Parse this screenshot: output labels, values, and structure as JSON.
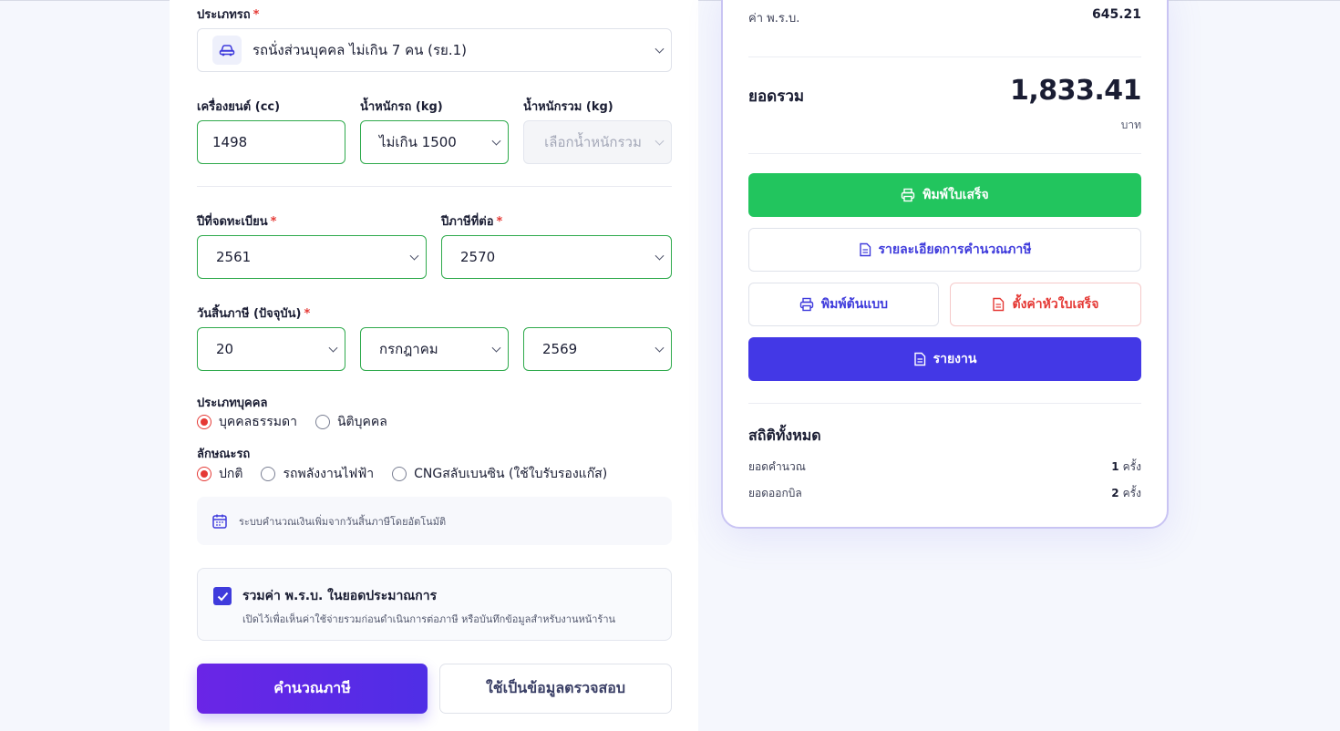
{
  "form": {
    "vehicle_type": {
      "label": "ประเภทรถ",
      "required_mark": "*",
      "value": "รถนั่งส่วนบุคคล ไม่เกิน 7 คน (รย.1)",
      "icon": "car-icon"
    },
    "engine_cc": {
      "label": "เครื่องยนต์ (cc)",
      "value": "1498"
    },
    "vehicle_weight": {
      "label": "น้ำหนักรถ (kg)",
      "value": "ไม่เกิน 1500"
    },
    "gross_weight": {
      "label": "น้ำหนักรวม (kg)",
      "placeholder": "เลือกน้ำหนักรวม"
    },
    "registration_year": {
      "label": "ปีที่จดทะเบียน",
      "required_mark": "*",
      "value": "2561"
    },
    "tax_year": {
      "label": "ปีภาษีที่ต่อ",
      "required_mark": "*",
      "value": "2570"
    },
    "tax_expiry": {
      "label": "วันสิ้นภาษี (ปัจจุบัน)",
      "required_mark": "*",
      "day": "20",
      "month": "กรกฎาคม",
      "year": "2569"
    },
    "person_type": {
      "label": "ประเภทบุคคล",
      "options": [
        "บุคคลธรรมดา",
        "นิติบุคคล"
      ],
      "selected": "บุคคลธรรมดา"
    },
    "vehicle_kind": {
      "label": "ลักษณะรถ",
      "options": [
        "ปกติ",
        "รถพลังงานไฟฟ้า",
        "CNGสลับเบนซิน (ใช้ใบรับรองแก๊ส)"
      ],
      "selected": "ปกติ"
    },
    "auto_note": "ระบบคำนวณเงินเพิ่มจากวันสิ้นภาษีโดยอัตโนมัติ",
    "include_prb": {
      "checked": true,
      "title": "รวมค่า พ.ร.บ. ในยอดประมาณการ",
      "description": "เปิดไว้เพื่อเห็นค่าใช้จ่ายรวมก่อนดำเนินการต่อภาษี หรือบันทึกข้อมูลสำหรับงานหน้าร้าน"
    },
    "calculate_label": "คำนวณภาษี",
    "test_data_label": "ใช้เป็นข้อมูลตรวจสอบ"
  },
  "summary": {
    "prb_label": "ค่า พ.ร.บ.",
    "prb_value": "645.21",
    "total_label": "ยอดรวม",
    "total_value": "1,833.41",
    "total_unit": "บาท",
    "print_receipt_label": "พิมพ์ใบเสร็จ",
    "tax_detail_label": "รายละเอียดการคำนวณภาษี",
    "print_draft_label": "พิมพ์ต้นแบบ",
    "receipt_header_label": "ตั้งค่าหัวใบเสร็จ",
    "report_label": "รายงาน",
    "stats_title": "สถิติทั้งหมด",
    "stats": [
      {
        "label": "ยอดคำนวณ",
        "count": "1",
        "unit": "ครั้ง"
      },
      {
        "label": "ยอดออกบิล",
        "count": "2",
        "unit": "ครั้ง"
      }
    ]
  },
  "colors": {
    "accent": "#4338e6",
    "success": "#22c55e",
    "danger": "#e53935",
    "field_border": "#2faa4c"
  }
}
